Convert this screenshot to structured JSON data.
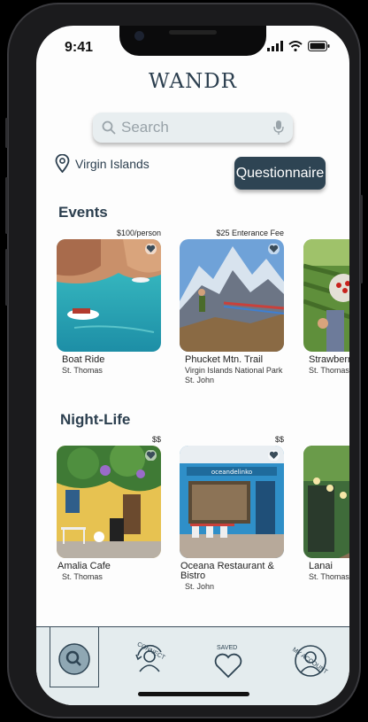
{
  "status_bar": {
    "time": "9:41"
  },
  "app": {
    "logo": "WANDR"
  },
  "search": {
    "placeholder": "Search"
  },
  "location": {
    "name": "Virgin Islands"
  },
  "questionnaire_button": {
    "label": "Questionnaire"
  },
  "events": {
    "title": "Events",
    "cards": [
      {
        "price": "$100/person",
        "name": "Boat Ride",
        "lines": [
          "St. Thomas"
        ]
      },
      {
        "price": "$25 Enterance Fee",
        "name": "Phucket Mtn. Trail",
        "lines": [
          "Virgin Islands National Park",
          "St. John"
        ]
      },
      {
        "price": "",
        "name": "Strawberry",
        "lines": [
          "St. Thomas"
        ]
      }
    ]
  },
  "nightlife": {
    "title": "Night-Life",
    "cards": [
      {
        "price": "$$",
        "name": "Amalia Cafe",
        "lines": [
          "St. Thomas"
        ]
      },
      {
        "price": "$$",
        "name": "Oceana Restaurant & Bistro",
        "lines": [
          "St. John"
        ]
      },
      {
        "price": "",
        "name": "Lanai",
        "lines": [
          "St. Thomas"
        ]
      }
    ]
  },
  "shop_sign": "oceandelinko",
  "tabs": [
    {
      "label": ""
    },
    {
      "label": "CONNECT"
    },
    {
      "label": "SAVED"
    },
    {
      "label": "MY ACCOUNT"
    }
  ],
  "colors": {
    "accent": "#2e4453",
    "tabbar": "#e4ecee",
    "text": "#2c3f4f"
  },
  "icons": [
    "search-icon",
    "mic-icon",
    "location-pin-icon",
    "heart-icon",
    "connect-icon",
    "saved-heart-icon",
    "account-icon"
  ]
}
